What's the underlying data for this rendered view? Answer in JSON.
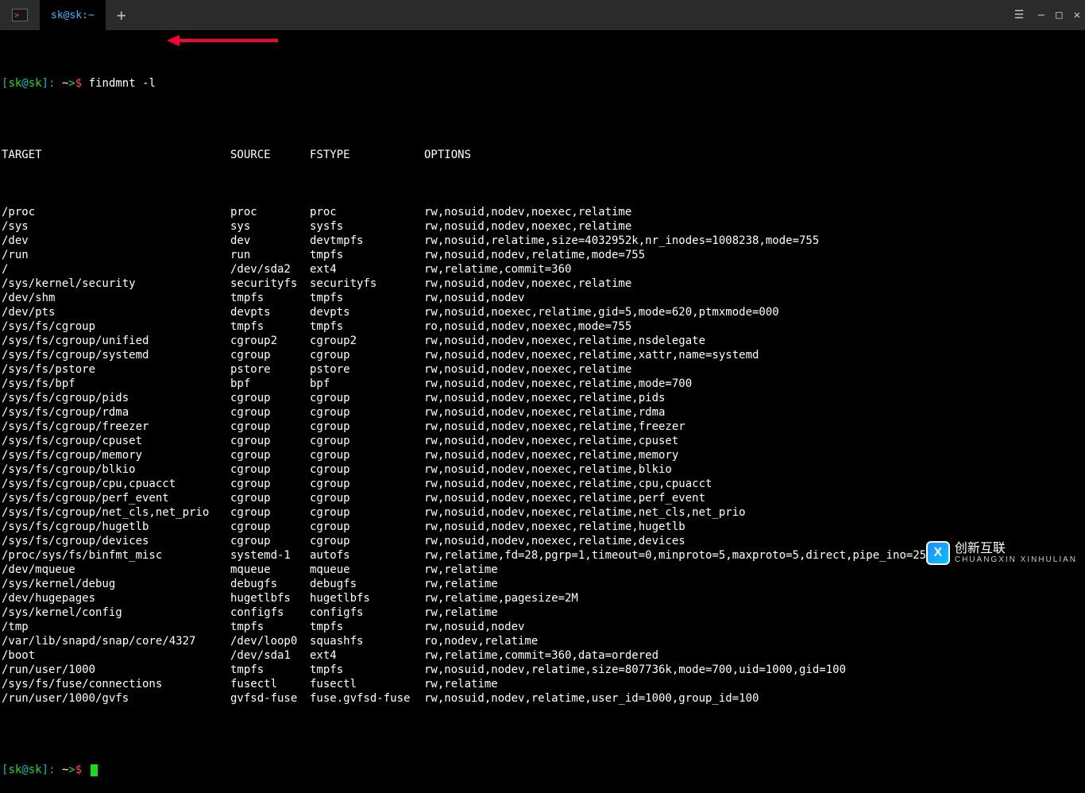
{
  "tabbar": {
    "active_tab_label": "sk@sk:~",
    "new_tab_glyph": "+",
    "win": {
      "min": "—",
      "max": "□",
      "close": "✕"
    }
  },
  "prompt": {
    "user": "sk",
    "host": "sk",
    "path": "~",
    "open": "[",
    "close": "]",
    "at": "@",
    "colon": ":",
    "gt": ">",
    "dollar": "$",
    "command": "findmnt -l"
  },
  "headers": {
    "target": "TARGET",
    "source": "SOURCE",
    "fstype": "FSTYPE",
    "options": "OPTIONS"
  },
  "rows": [
    {
      "target": "/proc",
      "source": "proc",
      "fstype": "proc",
      "options": "rw,nosuid,nodev,noexec,relatime"
    },
    {
      "target": "/sys",
      "source": "sys",
      "fstype": "sysfs",
      "options": "rw,nosuid,nodev,noexec,relatime"
    },
    {
      "target": "/dev",
      "source": "dev",
      "fstype": "devtmpfs",
      "options": "rw,nosuid,relatime,size=4032952k,nr_inodes=1008238,mode=755"
    },
    {
      "target": "/run",
      "source": "run",
      "fstype": "tmpfs",
      "options": "rw,nosuid,nodev,relatime,mode=755"
    },
    {
      "target": "/",
      "source": "/dev/sda2",
      "fstype": "ext4",
      "options": "rw,relatime,commit=360"
    },
    {
      "target": "/sys/kernel/security",
      "source": "securityfs",
      "fstype": "securityfs",
      "options": "rw,nosuid,nodev,noexec,relatime"
    },
    {
      "target": "/dev/shm",
      "source": "tmpfs",
      "fstype": "tmpfs",
      "options": "rw,nosuid,nodev"
    },
    {
      "target": "/dev/pts",
      "source": "devpts",
      "fstype": "devpts",
      "options": "rw,nosuid,noexec,relatime,gid=5,mode=620,ptmxmode=000"
    },
    {
      "target": "/sys/fs/cgroup",
      "source": "tmpfs",
      "fstype": "tmpfs",
      "options": "ro,nosuid,nodev,noexec,mode=755"
    },
    {
      "target": "/sys/fs/cgroup/unified",
      "source": "cgroup2",
      "fstype": "cgroup2",
      "options": "rw,nosuid,nodev,noexec,relatime,nsdelegate"
    },
    {
      "target": "/sys/fs/cgroup/systemd",
      "source": "cgroup",
      "fstype": "cgroup",
      "options": "rw,nosuid,nodev,noexec,relatime,xattr,name=systemd"
    },
    {
      "target": "/sys/fs/pstore",
      "source": "pstore",
      "fstype": "pstore",
      "options": "rw,nosuid,nodev,noexec,relatime"
    },
    {
      "target": "/sys/fs/bpf",
      "source": "bpf",
      "fstype": "bpf",
      "options": "rw,nosuid,nodev,noexec,relatime,mode=700"
    },
    {
      "target": "/sys/fs/cgroup/pids",
      "source": "cgroup",
      "fstype": "cgroup",
      "options": "rw,nosuid,nodev,noexec,relatime,pids"
    },
    {
      "target": "/sys/fs/cgroup/rdma",
      "source": "cgroup",
      "fstype": "cgroup",
      "options": "rw,nosuid,nodev,noexec,relatime,rdma"
    },
    {
      "target": "/sys/fs/cgroup/freezer",
      "source": "cgroup",
      "fstype": "cgroup",
      "options": "rw,nosuid,nodev,noexec,relatime,freezer"
    },
    {
      "target": "/sys/fs/cgroup/cpuset",
      "source": "cgroup",
      "fstype": "cgroup",
      "options": "rw,nosuid,nodev,noexec,relatime,cpuset"
    },
    {
      "target": "/sys/fs/cgroup/memory",
      "source": "cgroup",
      "fstype": "cgroup",
      "options": "rw,nosuid,nodev,noexec,relatime,memory"
    },
    {
      "target": "/sys/fs/cgroup/blkio",
      "source": "cgroup",
      "fstype": "cgroup",
      "options": "rw,nosuid,nodev,noexec,relatime,blkio"
    },
    {
      "target": "/sys/fs/cgroup/cpu,cpuacct",
      "source": "cgroup",
      "fstype": "cgroup",
      "options": "rw,nosuid,nodev,noexec,relatime,cpu,cpuacct"
    },
    {
      "target": "/sys/fs/cgroup/perf_event",
      "source": "cgroup",
      "fstype": "cgroup",
      "options": "rw,nosuid,nodev,noexec,relatime,perf_event"
    },
    {
      "target": "/sys/fs/cgroup/net_cls,net_prio",
      "source": "cgroup",
      "fstype": "cgroup",
      "options": "rw,nosuid,nodev,noexec,relatime,net_cls,net_prio"
    },
    {
      "target": "/sys/fs/cgroup/hugetlb",
      "source": "cgroup",
      "fstype": "cgroup",
      "options": "rw,nosuid,nodev,noexec,relatime,hugetlb"
    },
    {
      "target": "/sys/fs/cgroup/devices",
      "source": "cgroup",
      "fstype": "cgroup",
      "options": "rw,nosuid,nodev,noexec,relatime,devices"
    },
    {
      "target": "/proc/sys/fs/binfmt_misc",
      "source": "systemd-1",
      "fstype": "autofs",
      "options": "rw,relatime,fd=28,pgrp=1,timeout=0,minproto=5,maxproto=5,direct,pipe_ino=2500"
    },
    {
      "target": "/dev/mqueue",
      "source": "mqueue",
      "fstype": "mqueue",
      "options": "rw,relatime"
    },
    {
      "target": "/sys/kernel/debug",
      "source": "debugfs",
      "fstype": "debugfs",
      "options": "rw,relatime"
    },
    {
      "target": "/dev/hugepages",
      "source": "hugetlbfs",
      "fstype": "hugetlbfs",
      "options": "rw,relatime,pagesize=2M"
    },
    {
      "target": "/sys/kernel/config",
      "source": "configfs",
      "fstype": "configfs",
      "options": "rw,relatime"
    },
    {
      "target": "/tmp",
      "source": "tmpfs",
      "fstype": "tmpfs",
      "options": "rw,nosuid,nodev"
    },
    {
      "target": "/var/lib/snapd/snap/core/4327",
      "source": "/dev/loop0",
      "fstype": "squashfs",
      "options": "ro,nodev,relatime"
    },
    {
      "target": "/boot",
      "source": "/dev/sda1",
      "fstype": "ext4",
      "options": "rw,relatime,commit=360,data=ordered"
    },
    {
      "target": "/run/user/1000",
      "source": "tmpfs",
      "fstype": "tmpfs",
      "options": "rw,nosuid,nodev,relatime,size=807736k,mode=700,uid=1000,gid=100"
    },
    {
      "target": "/sys/fs/fuse/connections",
      "source": "fusectl",
      "fstype": "fusectl",
      "options": "rw,relatime"
    },
    {
      "target": "/run/user/1000/gvfs",
      "source": "gvfsd-fuse",
      "fstype": "fuse.gvfsd-fuse",
      "options": "rw,nosuid,nodev,relatime,user_id=1000,group_id=100"
    }
  ],
  "watermark": {
    "brand": "创新互联",
    "sub": "CHUANGXIN XINHULIAN",
    "badge": "X"
  }
}
